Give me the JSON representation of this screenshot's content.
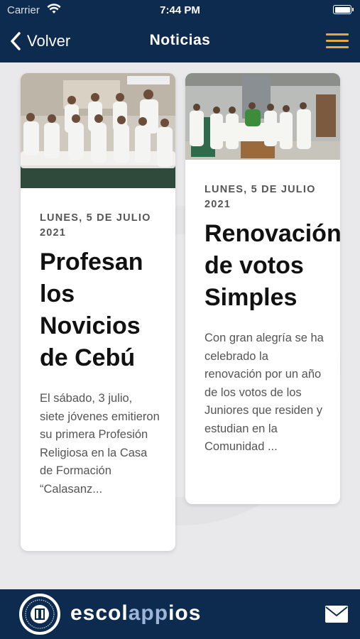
{
  "status_bar": {
    "carrier": "Carrier",
    "time": "7:44 PM"
  },
  "nav": {
    "back_label": "Volver",
    "title": "Noticias"
  },
  "colors": {
    "navy": "#0d2a4f",
    "accent_gold": "#e5a83a",
    "background": "#e9e9eb"
  },
  "articles": [
    {
      "date": "LUNES, 5 DE JULIO 2021",
      "title": "Profesan los Novicios de Cebú",
      "excerpt": "El sábado, 3 julio, siete jóvenes emitieron su primera Profesión Religiosa en la Casa de Formación “Calasanz..."
    },
    {
      "date": "LUNES, 5 DE JULIO 2021",
      "title": "Renovación de votos Simples",
      "excerpt": "Con gran alegría se ha celebrado la renovación por un año de los votos de los Juniores que residen y estudian en la Comunidad ..."
    }
  ],
  "footer": {
    "brand_part1": "escol",
    "brand_part2": "app",
    "brand_part3": "ios",
    "icons": [
      "seal-logo",
      "mail-icon"
    ]
  }
}
